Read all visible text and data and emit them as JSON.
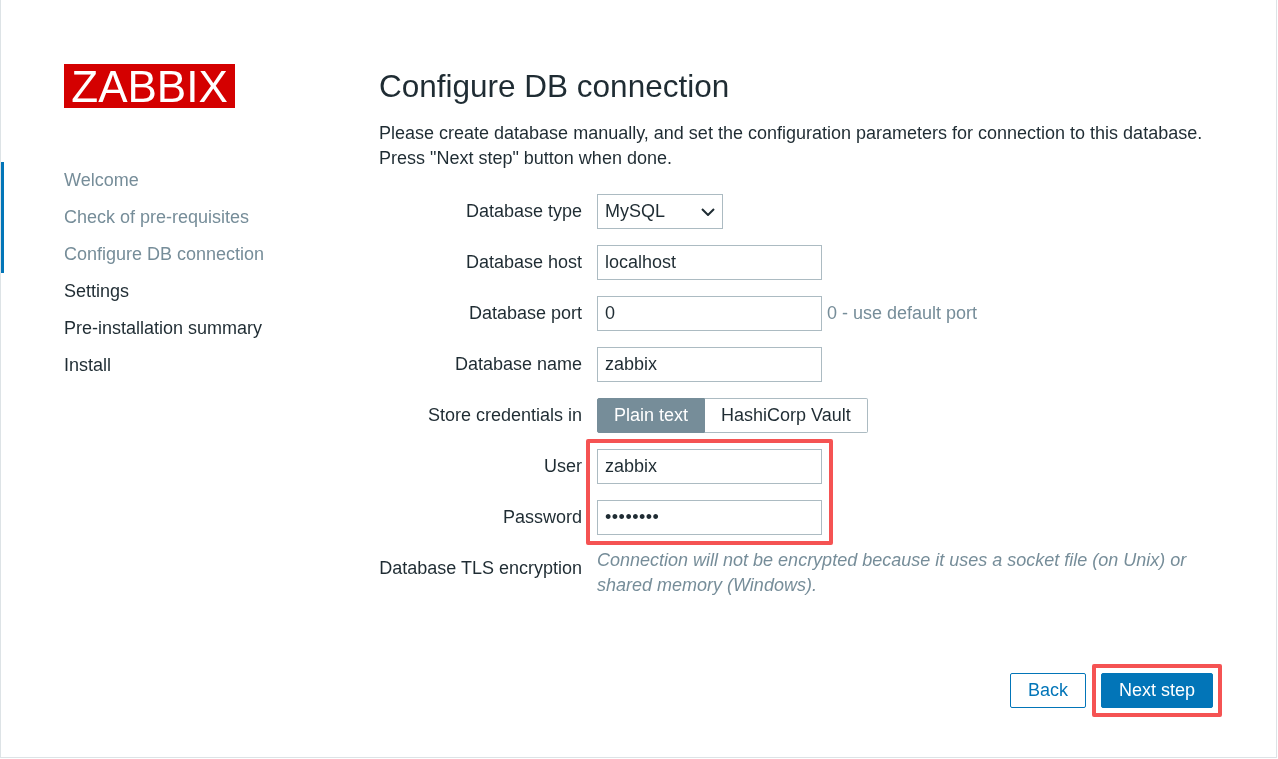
{
  "logo": {
    "text": "ZABBIX"
  },
  "steps": [
    {
      "label": "Welcome",
      "completed": true
    },
    {
      "label": "Check of pre-requisites",
      "completed": true
    },
    {
      "label": "Configure DB connection",
      "completed": true
    },
    {
      "label": "Settings",
      "completed": false
    },
    {
      "label": "Pre-installation summary",
      "completed": false
    },
    {
      "label": "Install",
      "completed": false
    }
  ],
  "page": {
    "title": "Configure DB connection",
    "intro": "Please create database manually, and set the configuration parameters for connection to this database. Press \"Next step\" button when done."
  },
  "form": {
    "rows": [
      {
        "kind": "select",
        "label": "Database type",
        "value": "MySQL",
        "highlighted": false
      },
      {
        "kind": "text",
        "label": "Database host",
        "value": "localhost",
        "highlighted": false
      },
      {
        "kind": "text",
        "label": "Database port",
        "value": "0",
        "hint": "0 - use default port",
        "highlighted": false
      },
      {
        "kind": "text",
        "label": "Database name",
        "value": "zabbix",
        "highlighted": false
      },
      {
        "kind": "segmented",
        "label": "Store credentials in",
        "options": [
          {
            "label": "Plain text",
            "selected": true
          },
          {
            "label": "HashiCorp Vault",
            "selected": false
          }
        ],
        "highlighted": false
      },
      {
        "kind": "text",
        "label": "User",
        "value": "zabbix",
        "highlighted": true
      },
      {
        "kind": "password",
        "label": "Password",
        "value": "••••••••",
        "highlighted": true
      },
      {
        "kind": "note",
        "label": "Database TLS encryption",
        "text": "Connection will not be encrypted because it uses a socket file (on Unix) or shared memory (Windows).",
        "highlighted": false
      }
    ]
  },
  "buttons": [
    {
      "label": "Back",
      "kind": "secondary",
      "highlighted": false
    },
    {
      "label": "Next step",
      "kind": "primary",
      "highlighted": true
    }
  ]
}
